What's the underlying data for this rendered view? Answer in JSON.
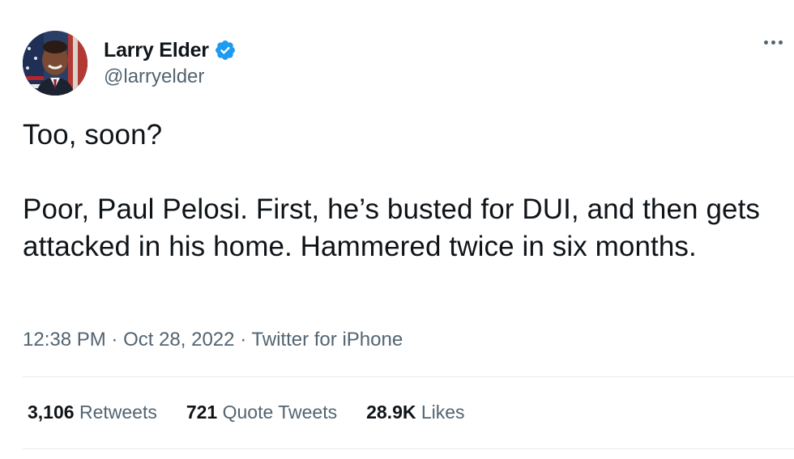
{
  "author": {
    "display_name": "Larry Elder",
    "handle": "@larryelder",
    "avatar_icon": "avatar-photo",
    "verified_icon": "verified-badge-icon"
  },
  "more_icon": "more-options-icon",
  "tweet": {
    "lines": [
      "Too, soon?",
      "Poor, Paul Pelosi. First, he’s busted for DUI, and then gets attacked in his home. Hammered twice in six months."
    ]
  },
  "meta": {
    "time": "12:38 PM",
    "separator": "·",
    "date": "Oct 28, 2022",
    "source": "Twitter for iPhone"
  },
  "stats": {
    "retweets_count": "3,106",
    "retweets_label": "Retweets",
    "quotes_count": "721",
    "quotes_label": "Quote Tweets",
    "likes_count": "28.9K",
    "likes_label": "Likes"
  },
  "colors": {
    "text_primary": "#0f1419",
    "text_secondary": "#536471",
    "verified_blue": "#1d9bf0",
    "divider": "#e7e9ea"
  }
}
